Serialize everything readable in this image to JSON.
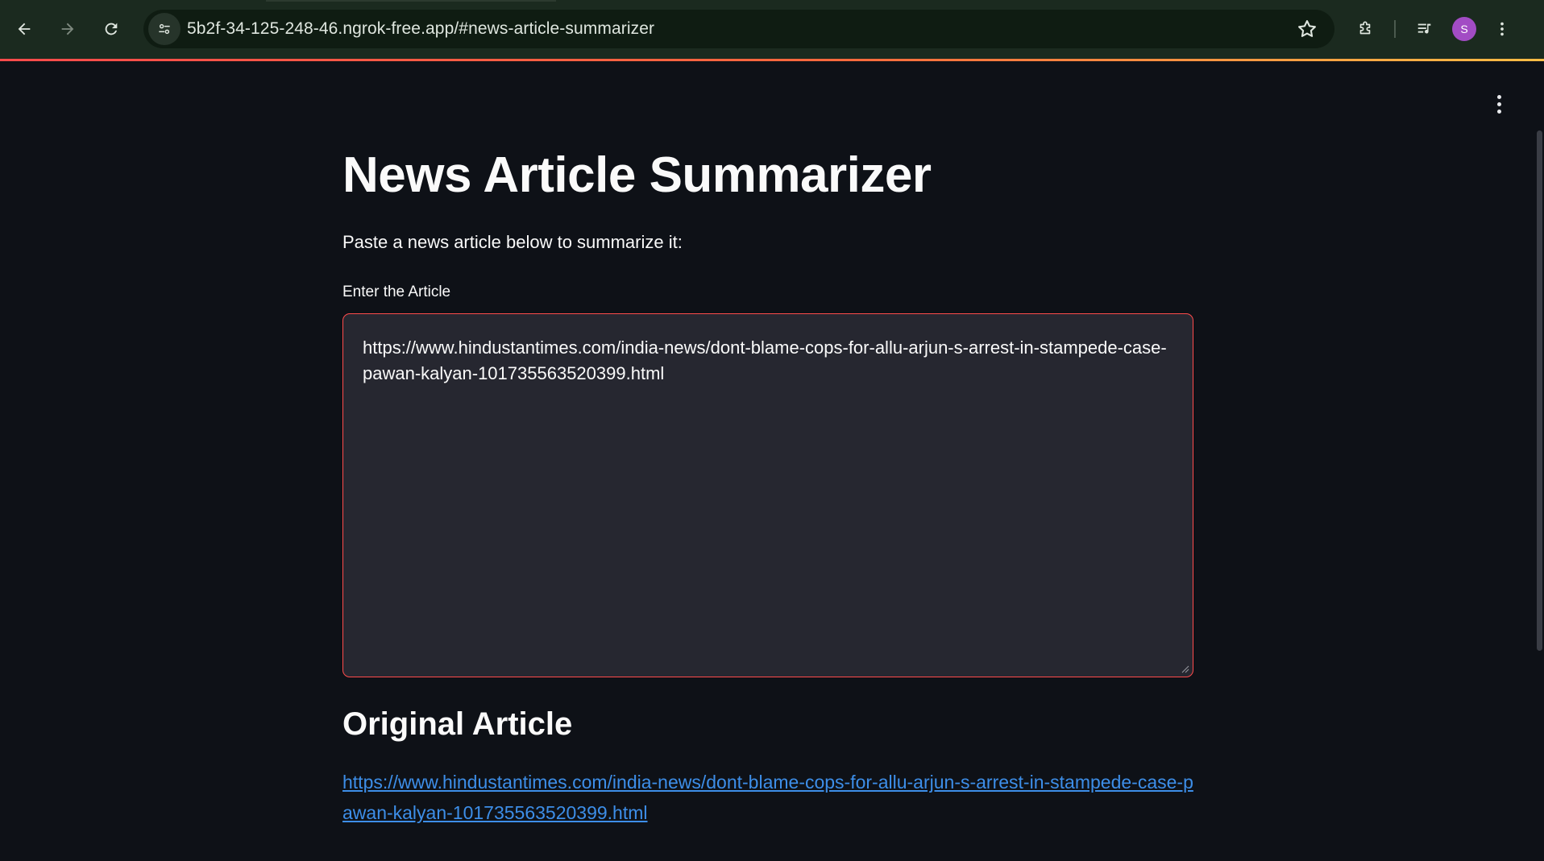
{
  "browser": {
    "url": "5b2f-34-125-248-46.ngrok-free.app/#news-article-summarizer",
    "avatar_initial": "S",
    "icons": {
      "back": "back-arrow-icon",
      "forward": "forward-arrow-icon",
      "reload": "reload-icon",
      "site_info": "tune-icon",
      "bookmark": "star-icon",
      "extensions": "puzzle-icon",
      "media": "media-queue-icon",
      "menu": "kebab-menu-icon"
    }
  },
  "app": {
    "title": "News Article Summarizer",
    "subtitle": "Paste a news article below to summarize it:",
    "input_label": "Enter the Article",
    "input_value": "https://www.hindustantimes.com/india-news/dont-blame-cops-for-allu-arjun-s-arrest-in-stampede-case-pawan-kalyan-101735563520399.html",
    "original_heading": "Original Article",
    "original_link": "https://www.hindustantimes.com/india-news/dont-blame-cops-for-allu-arjun-s-arrest-in-stampede-case-pawan-kalyan-101735563520399.html",
    "accent_color": "#ff4b4b",
    "link_color": "#3d8ee8"
  }
}
